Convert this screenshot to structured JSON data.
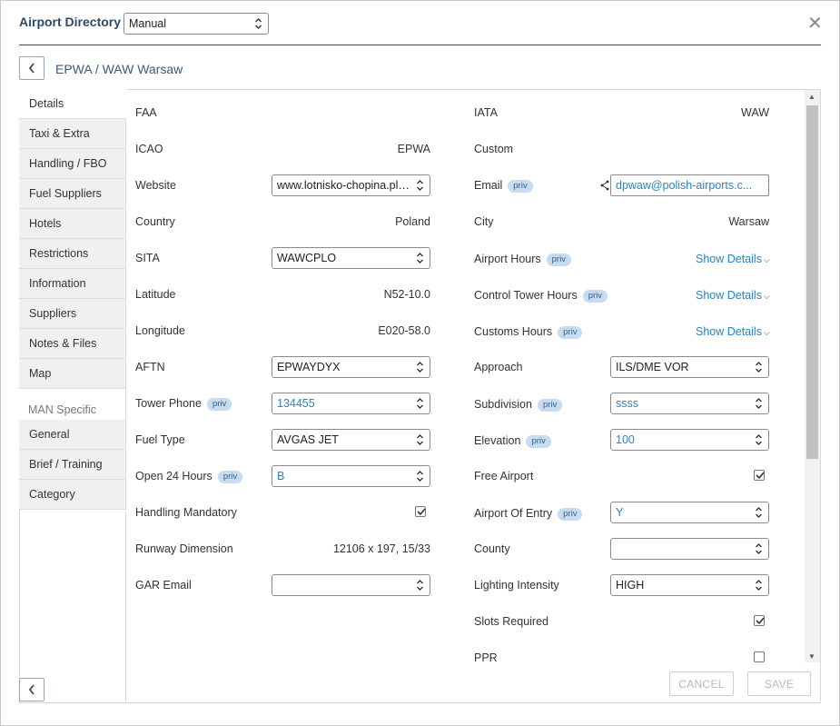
{
  "header": {
    "title": "Airport Directory",
    "mode_value": "Manual"
  },
  "breadcrumb": "EPWA / WAW Warsaw",
  "nav": {
    "items": [
      "Details",
      "Taxi & Extra",
      "Handling / FBO",
      "Fuel Suppliers",
      "Hotels",
      "Restrictions",
      "Information",
      "Suppliers",
      "Notes & Files",
      "Map"
    ],
    "section": "MAN Specific",
    "section_items": [
      "General",
      "Brief / Training",
      "Category"
    ]
  },
  "priv_label": "priv",
  "left": {
    "faa": {
      "label": "FAA",
      "value": ""
    },
    "icao": {
      "label": "ICAO",
      "value": "EPWA"
    },
    "website": {
      "label": "Website",
      "value": "www.lotnisko-chopina.pl/..."
    },
    "country": {
      "label": "Country",
      "value": "Poland"
    },
    "sita": {
      "label": "SITA",
      "value": "WAWCPLO"
    },
    "latitude": {
      "label": "Latitude",
      "value": "N52-10.0"
    },
    "longitude": {
      "label": "Longitude",
      "value": "E020-58.0"
    },
    "aftn": {
      "label": "AFTN",
      "value": "EPWAYDYX"
    },
    "tower_phone": {
      "label": "Tower Phone",
      "value": "134455"
    },
    "fuel_type": {
      "label": "Fuel Type",
      "value": "AVGAS JET"
    },
    "open24": {
      "label": "Open 24 Hours",
      "value": "B"
    },
    "handling_mandatory": {
      "label": "Handling Mandatory",
      "checked": true
    },
    "runway_dimension": {
      "label": "Runway Dimension",
      "value": "12106 x 197, 15/33"
    },
    "gar_email": {
      "label": "GAR Email",
      "value": ""
    }
  },
  "right": {
    "iata": {
      "label": "IATA",
      "value": "WAW"
    },
    "custom": {
      "label": "Custom",
      "value": ""
    },
    "email": {
      "label": "Email",
      "value": "dpwaw@polish-airports.c..."
    },
    "city": {
      "label": "City",
      "value": "Warsaw"
    },
    "airport_hours": {
      "label": "Airport Hours",
      "link": "Show Details"
    },
    "control_tower_hours": {
      "label": "Control Tower Hours",
      "link": "Show Details"
    },
    "customs_hours": {
      "label": "Customs Hours",
      "link": "Show Details"
    },
    "approach": {
      "label": "Approach",
      "value": "ILS/DME VOR"
    },
    "subdivision": {
      "label": "Subdivision",
      "value": "ssss"
    },
    "elevation": {
      "label": "Elevation",
      "value": "100"
    },
    "free_airport": {
      "label": "Free Airport",
      "checked": true
    },
    "airport_of_entry": {
      "label": "Airport Of Entry",
      "value": "Y"
    },
    "county": {
      "label": "County",
      "value": ""
    },
    "lighting_intensity": {
      "label": "Lighting Intensity",
      "value": "HIGH"
    },
    "slots_required": {
      "label": "Slots Required",
      "checked": true
    },
    "ppr": {
      "label": "PPR",
      "checked": false
    }
  },
  "footer": {
    "cancel": "CANCEL",
    "save": "SAVE"
  },
  "colors": {
    "accent": "#2a84c0",
    "header_text": "#2e4a66",
    "priv_badge": "#c8dcef"
  }
}
